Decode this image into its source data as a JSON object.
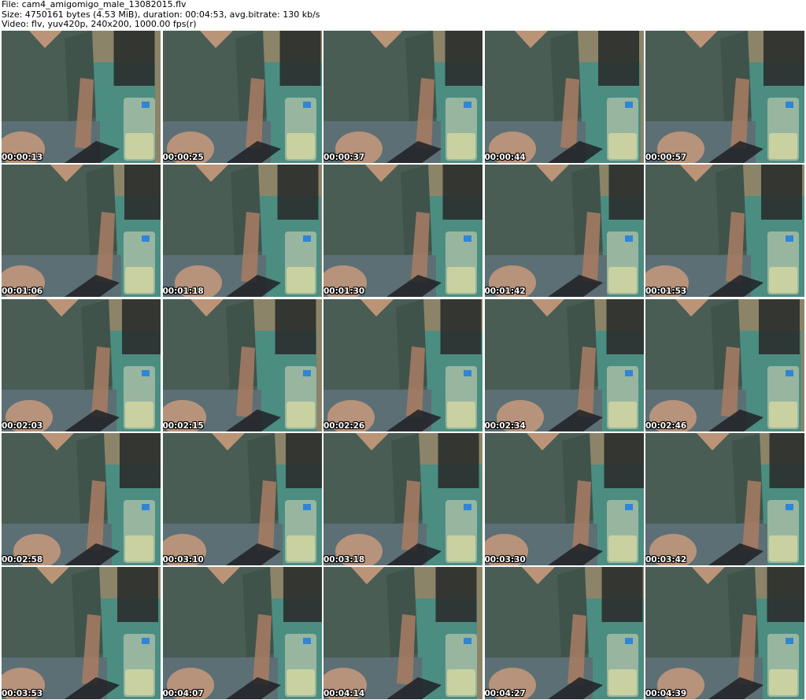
{
  "header": {
    "file_line": "File: cam4_amigomigo_male_13082015.flv",
    "size_line": "Size: 4750161 bytes (4.53 MiB), duration: 00:04:53, avg.bitrate: 130 kb/s",
    "video_line": "Video: flv, yuv420p, 240x200, 1000.00 fps(r)"
  },
  "palette": {
    "shirt": "#4a5d54",
    "shirt_dark": "#3b4d46",
    "skin": "#c89a7c",
    "skin_dark": "#a97c63",
    "teal": "#3f8f86",
    "wall": "#8c8468",
    "glass": "#d8d7b8",
    "dark": "#2a2e2c",
    "blue_sticker": "#2f86d8"
  },
  "thumbnails": [
    {
      "time": "00:00:13"
    },
    {
      "time": "00:00:25"
    },
    {
      "time": "00:00:37"
    },
    {
      "time": "00:00:44"
    },
    {
      "time": "00:00:57"
    },
    {
      "time": "00:01:06"
    },
    {
      "time": "00:01:18"
    },
    {
      "time": "00:01:30"
    },
    {
      "time": "00:01:42"
    },
    {
      "time": "00:01:53"
    },
    {
      "time": "00:02:03"
    },
    {
      "time": "00:02:15"
    },
    {
      "time": "00:02:26"
    },
    {
      "time": "00:02:34"
    },
    {
      "time": "00:02:46"
    },
    {
      "time": "00:02:58"
    },
    {
      "time": "00:03:10"
    },
    {
      "time": "00:03:18"
    },
    {
      "time": "00:03:30"
    },
    {
      "time": "00:03:42"
    },
    {
      "time": "00:03:53"
    },
    {
      "time": "00:04:07"
    },
    {
      "time": "00:04:14"
    },
    {
      "time": "00:04:27"
    },
    {
      "time": "00:04:39"
    }
  ]
}
